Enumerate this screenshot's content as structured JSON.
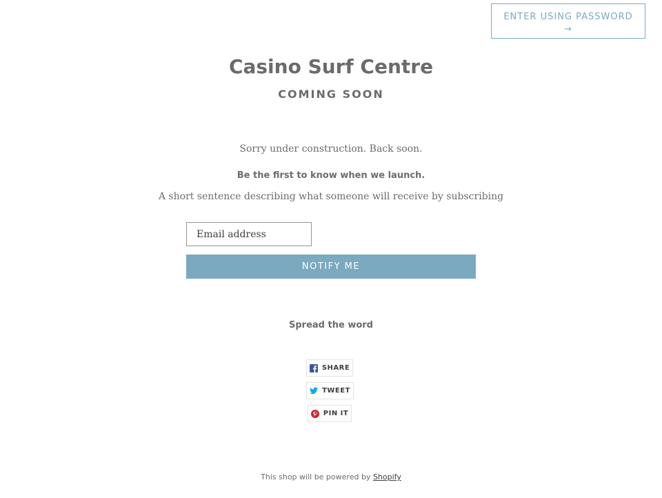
{
  "header": {
    "enter_password_label": "ENTER USING PASSWORD",
    "enter_password_arrow": "→"
  },
  "store": {
    "name": "Casino Surf Centre",
    "status": "COMING SOON"
  },
  "message": "Sorry under construction. Back soon.",
  "newsletter": {
    "heading": "Be the first to know when we launch.",
    "description": "A short sentence describing what someone will receive by subscribing",
    "email_placeholder": "Email address",
    "submit_label": "NOTIFY ME"
  },
  "social": {
    "heading": "Spread the word",
    "buttons": [
      {
        "label": "SHARE",
        "icon": "facebook-icon",
        "color": "#3b5998"
      },
      {
        "label": "TWEET",
        "icon": "twitter-icon",
        "color": "#00aced"
      },
      {
        "label": "PIN IT",
        "icon": "pinterest-icon",
        "color": "#cb2027"
      }
    ]
  },
  "footer": {
    "text": "This shop will be powered by ",
    "link": "Shopify"
  },
  "colors": {
    "accent": "#7aa9c0",
    "text": "#6b6b6b"
  }
}
